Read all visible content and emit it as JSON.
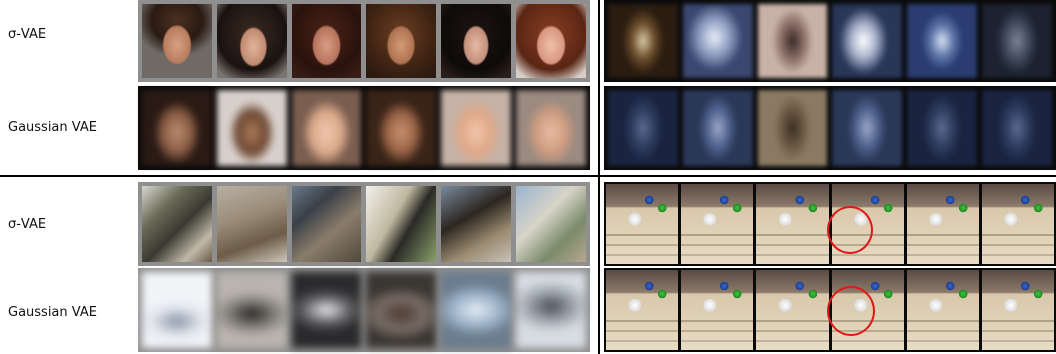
{
  "rows": [
    {
      "label": "σ-VAE"
    },
    {
      "label": "Gaussian VAE"
    },
    {
      "label": "σ-VAE"
    },
    {
      "label": "Gaussian VAE"
    }
  ],
  "annotation": {
    "highlight_color": "#e01818"
  }
}
